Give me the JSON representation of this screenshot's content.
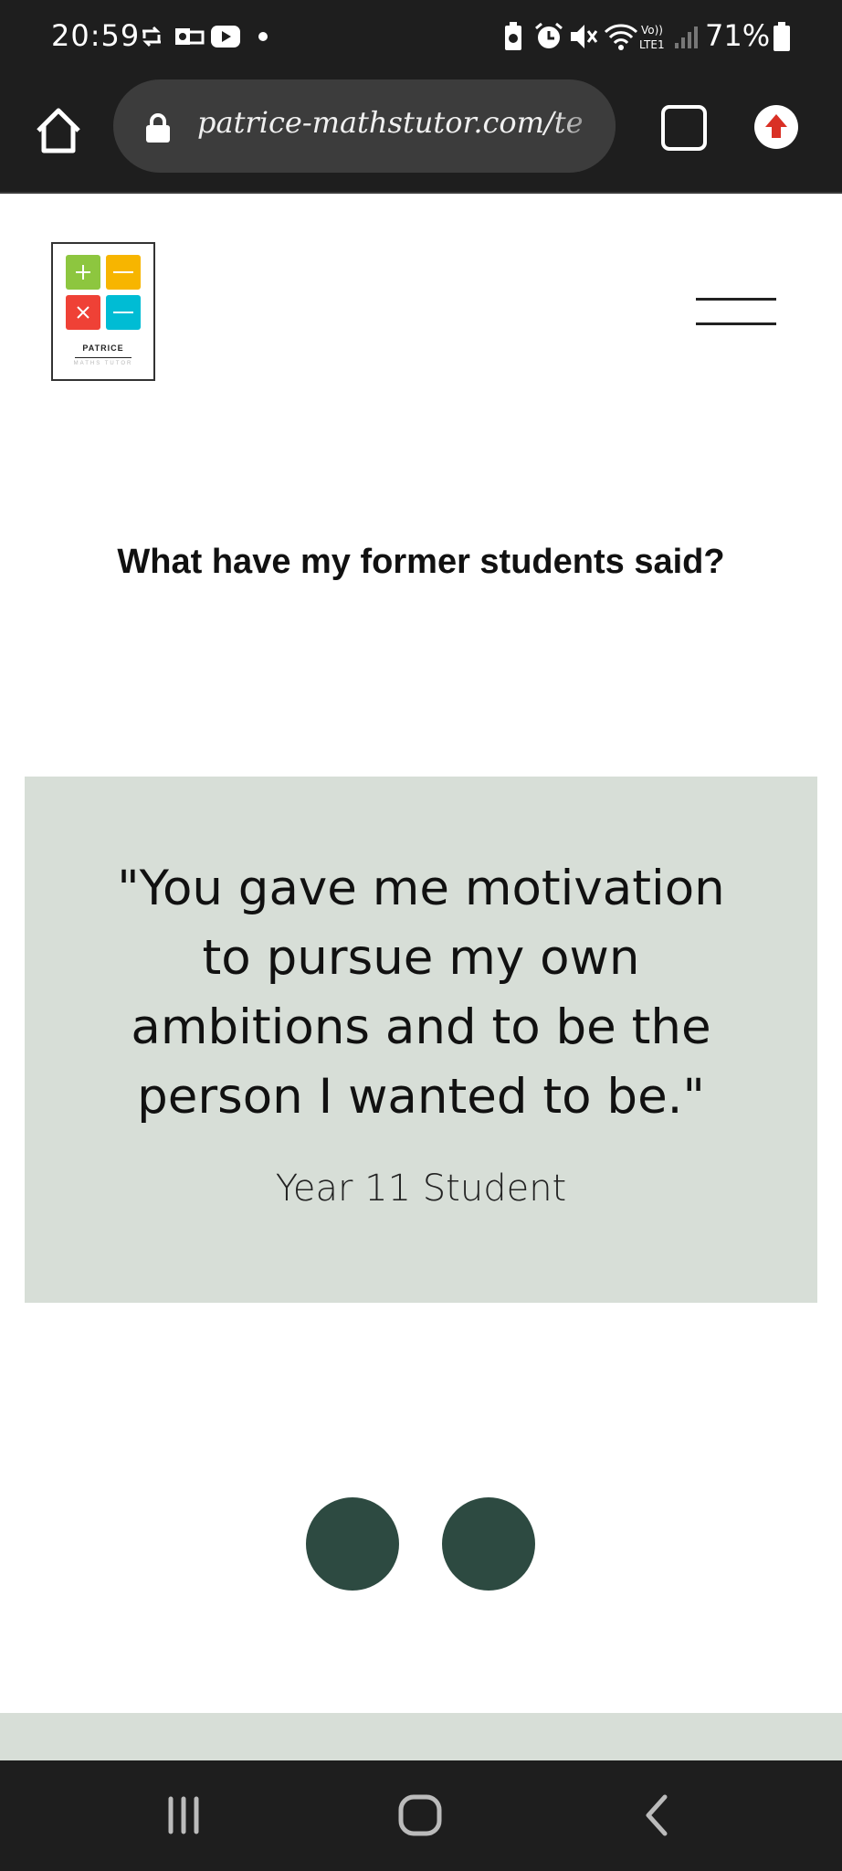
{
  "status_bar": {
    "time": "20:59",
    "battery": "71%",
    "icons": [
      "sync-icon",
      "outlook-icon",
      "youtube-icon",
      "dot-icon",
      "battery-saver-icon",
      "alarm-icon",
      "mute-icon",
      "wifi-icon",
      "volte-icon",
      "signal-icon",
      "battery-icon"
    ]
  },
  "browser": {
    "url": "patrice-mathstutor.com/te",
    "tabs_count": "",
    "colors": {
      "bar": "#1e1e1e",
      "pill": "#3c3c3c",
      "update": "#d93025"
    }
  },
  "page": {
    "logo": {
      "name": "PATRICE",
      "sub": "MATHS TUTOR",
      "tiles": {
        "plus": "#8dc63f",
        "minus_top": "#f7b500",
        "times": "#ef4136",
        "minus_bottom": "#00bcd4"
      }
    },
    "heading": "What have my former students said?",
    "testimonial": {
      "quote": "\"You gave me motivation to pursue my own ambitions and to be the person I wanted to be.\"",
      "author": "Year 11 Student",
      "card_color": "#d7ded7"
    },
    "slider": {
      "button_color": "#2d4a41"
    }
  },
  "nav_bar": {
    "buttons": [
      "recent-apps",
      "home",
      "back"
    ]
  }
}
